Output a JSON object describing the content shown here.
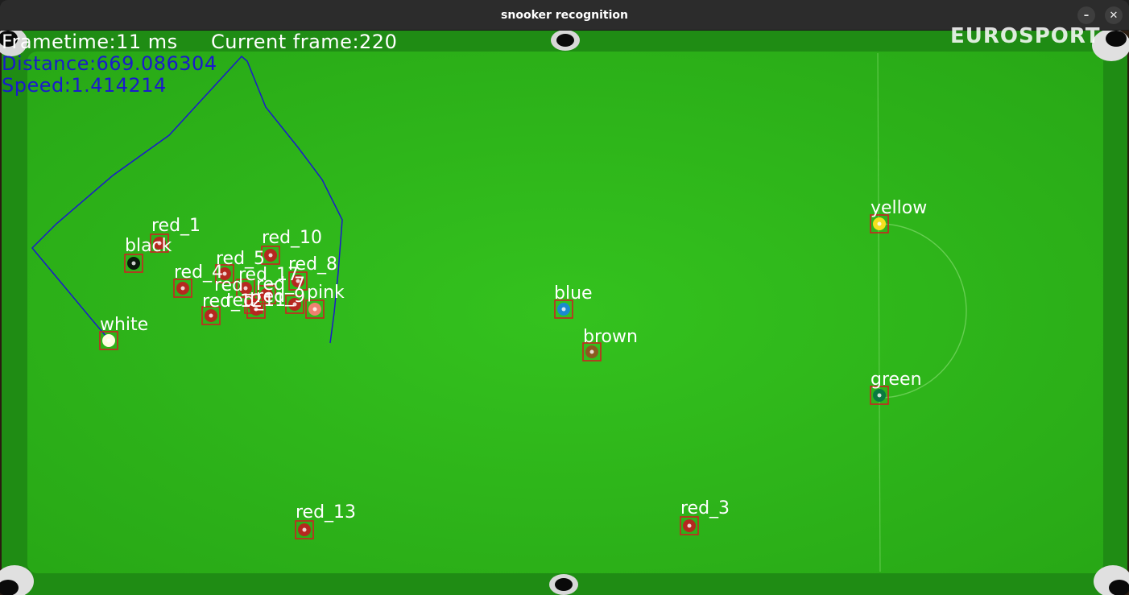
{
  "window": {
    "title": "snooker recognition",
    "minimize_glyph": "–",
    "close_glyph": "✕"
  },
  "hud": {
    "frametime": "Frametime:11 ms",
    "current_frame": "Current frame:220",
    "distance": "Distance:669.086304",
    "speed": "Speed:1.414214"
  },
  "watermark": "EUROSPORT",
  "colors": {
    "cloth": "#2eb81a",
    "cushion": "#1e8a14",
    "rail": "#3a2a1e",
    "box": "#cc2222",
    "trajectory": "#1a1acc",
    "hud_text": "#ffffff"
  },
  "balls": [
    {
      "name": "red_1",
      "label": "red_1",
      "color": "#b5281f"
    },
    {
      "name": "black",
      "label": "black",
      "color": "#0a1a0a"
    },
    {
      "name": "red_10",
      "label": "red_10",
      "color": "#b5281f"
    },
    {
      "name": "red_5",
      "label": "red_5",
      "color": "#b5281f"
    },
    {
      "name": "red_8",
      "label": "red_8",
      "color": "#b5281f"
    },
    {
      "name": "red_4",
      "label": "red_4",
      "color": "#b5281f"
    },
    {
      "name": "red_17",
      "label": "red_17",
      "color": "#b5281f"
    },
    {
      "name": "red_x1",
      "label": "red_",
      "color": "#b5281f"
    },
    {
      "name": "red_x2",
      "label": "red_7",
      "color": "#b5281f"
    },
    {
      "name": "red_x3",
      "label": "red_9",
      "color": "#b5281f"
    },
    {
      "name": "red_11",
      "label": "red_11",
      "color": "#b5281f"
    },
    {
      "name": "red_12",
      "label": "red_12",
      "color": "#b5281f"
    },
    {
      "name": "pink",
      "label": "pink",
      "color": "#f08070"
    },
    {
      "name": "white",
      "label": "white",
      "color": "#fffde0"
    },
    {
      "name": "blue",
      "label": "blue",
      "color": "#1a8ad0"
    },
    {
      "name": "brown",
      "label": "brown",
      "color": "#8a5a20"
    },
    {
      "name": "yellow",
      "label": "yellow",
      "color": "#f5e020"
    },
    {
      "name": "green",
      "label": "green",
      "color": "#0a7a40"
    },
    {
      "name": "red_13",
      "label": "red_13",
      "color": "#b5281f"
    },
    {
      "name": "red_3",
      "label": "red_3",
      "color": "#b5281f"
    }
  ]
}
